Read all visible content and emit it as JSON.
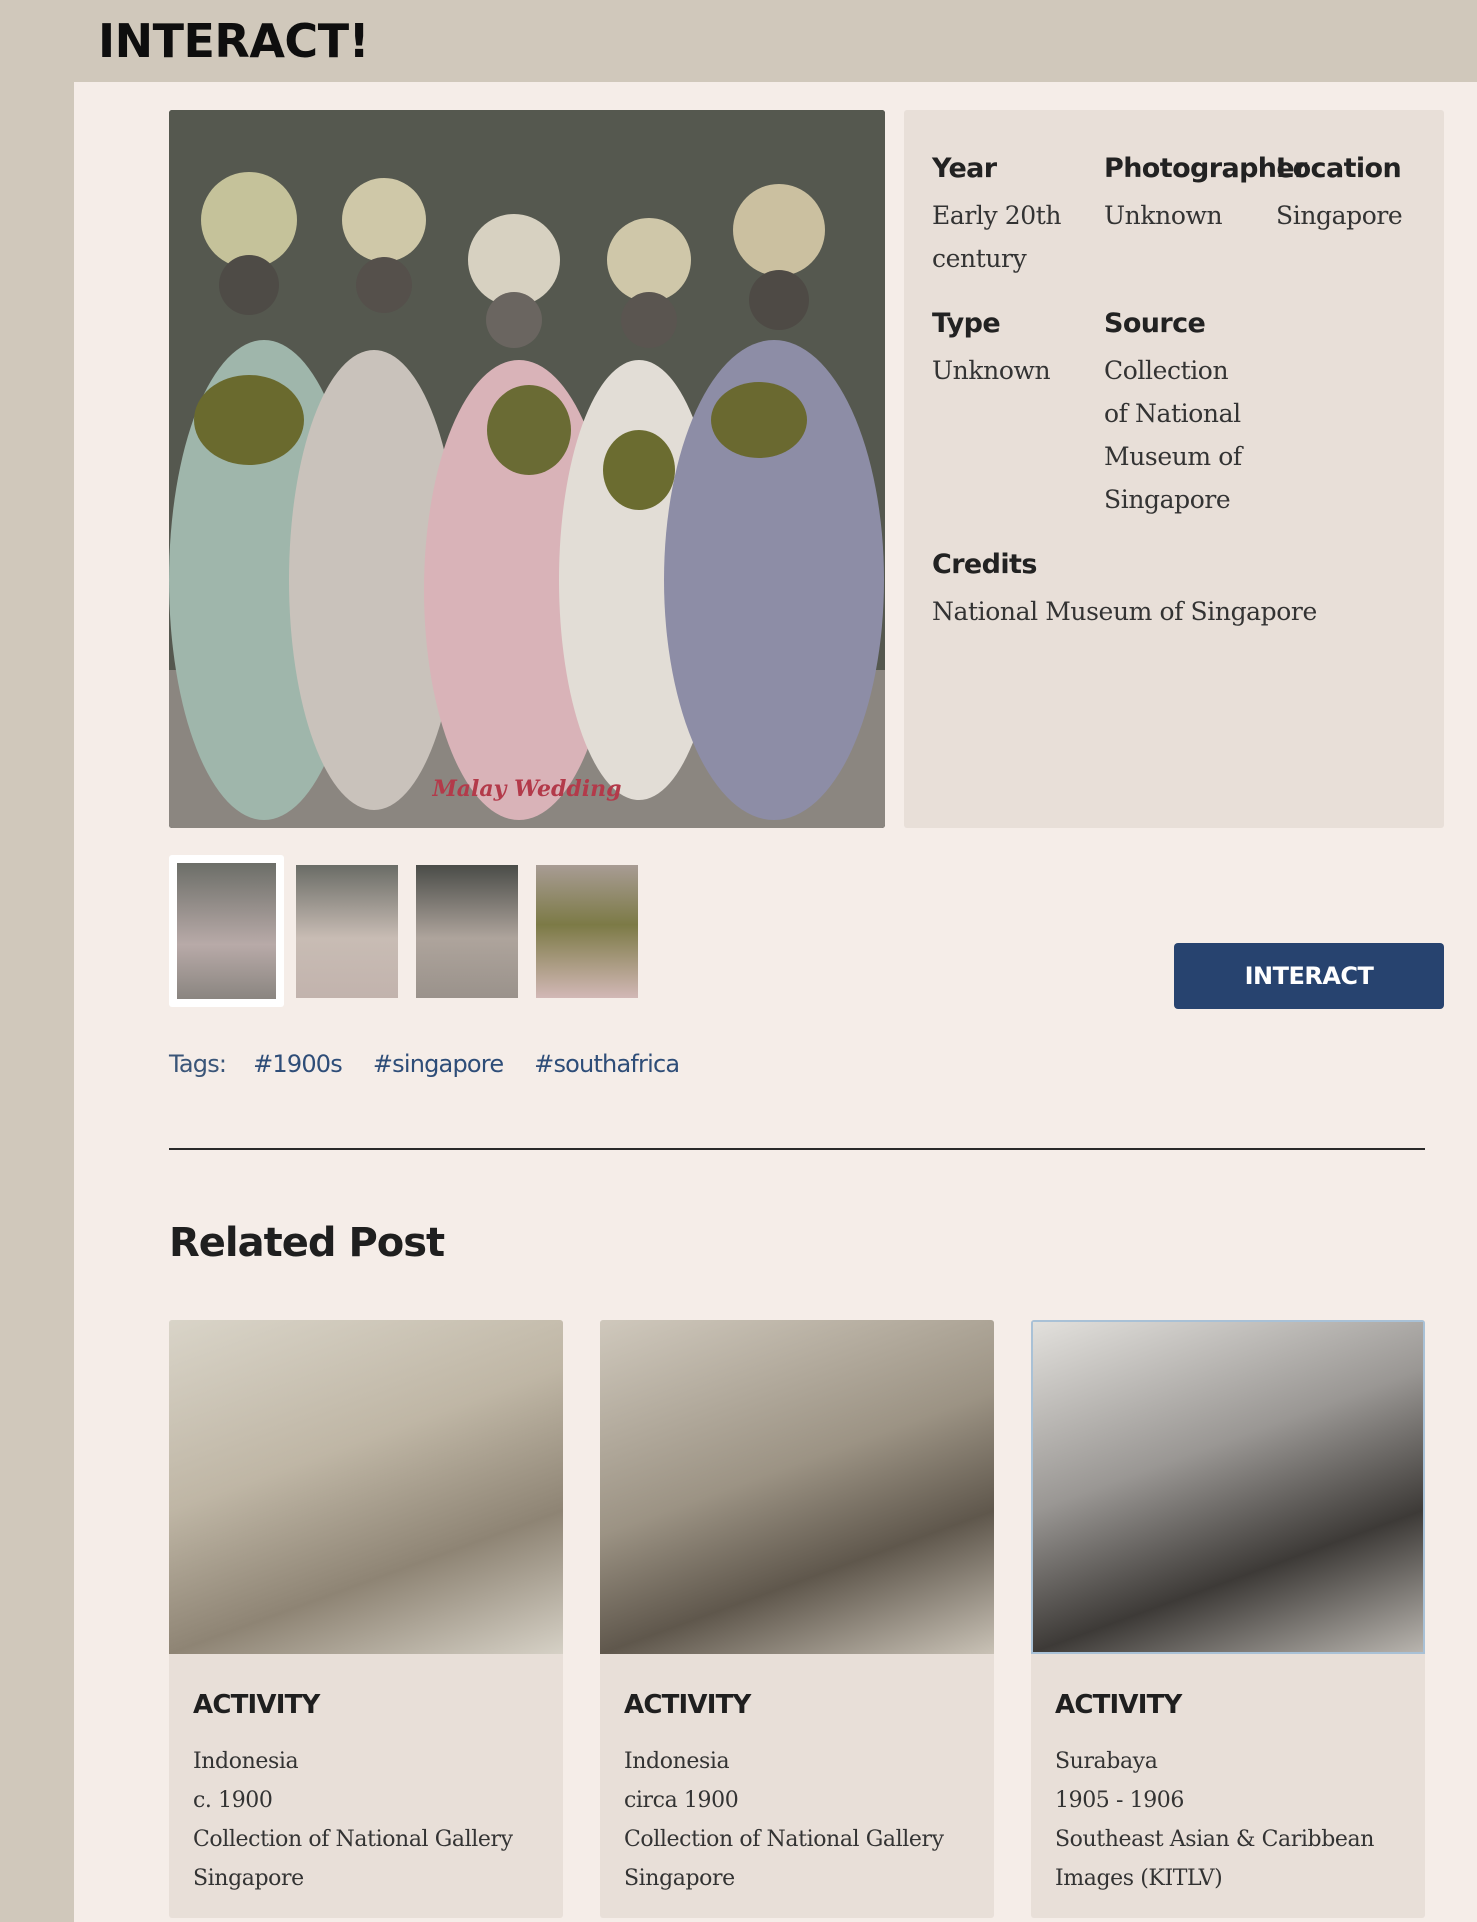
{
  "header": {
    "brand": "INTERACT!"
  },
  "main_photo": {
    "caption": "Malay Wedding"
  },
  "meta": {
    "year_label": "Year",
    "year_value": "Early 20th century",
    "photographer_label": "Photographer",
    "photographer_value": "Unknown",
    "location_label": "Location",
    "location_value": "Singapore",
    "type_label": "Type",
    "type_value": "Unknown",
    "source_label": "Source",
    "source_value": "Collection of National Museum of Singapore",
    "credits_label": "Credits",
    "credits_value": "National Museum of Singapore"
  },
  "actions": {
    "interact_label": "INTERACT"
  },
  "tags": {
    "label": "Tags:",
    "items": [
      "#1900s",
      "#singapore",
      "#southafrica"
    ]
  },
  "related": {
    "title": "Related Post",
    "cards": [
      {
        "category": "ACTIVITY",
        "place": "Indonesia",
        "date": "c. 1900",
        "source": "Collection of National Gallery Singapore"
      },
      {
        "category": "ACTIVITY",
        "place": "Indonesia",
        "date": "circa 1900",
        "source": "Collection of National Gallery Singapore"
      },
      {
        "category": "ACTIVITY",
        "place": "Surabaya",
        "date": "1905 - 1906",
        "source": "Southeast Asian & Caribbean Images (KITLV)"
      }
    ]
  }
}
